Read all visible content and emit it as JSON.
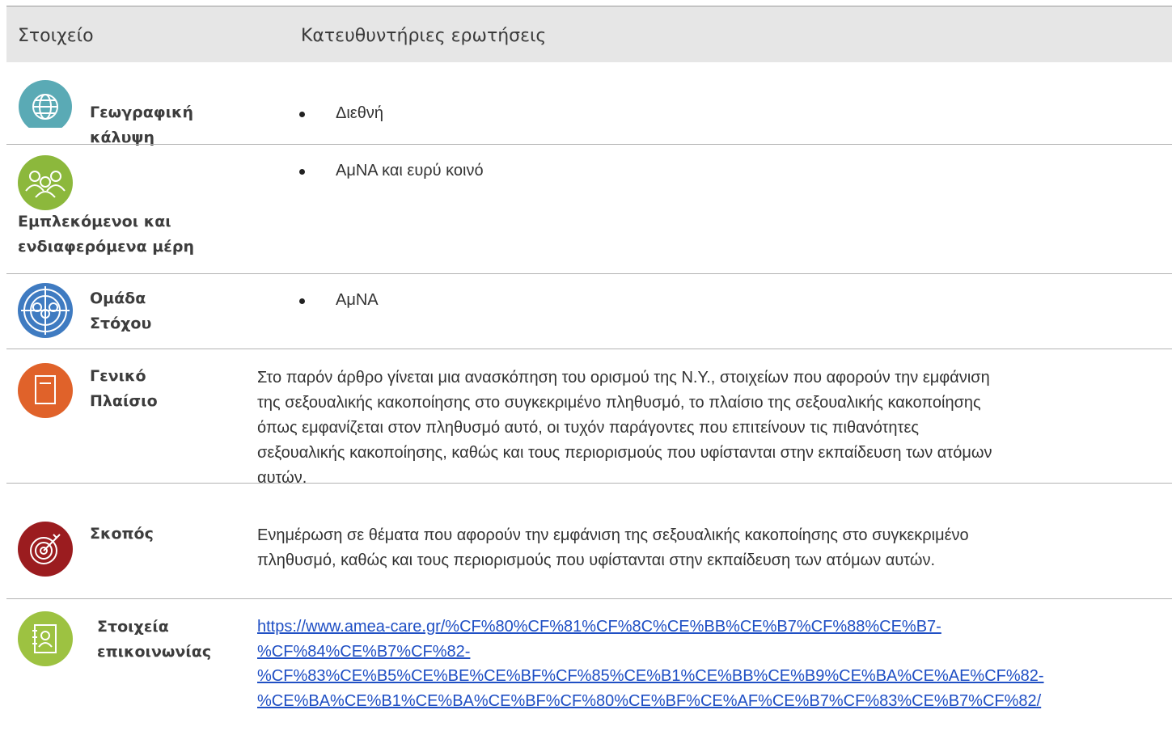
{
  "header": {
    "col1": "Στοιχείο",
    "col2": "Κατευθυντήριες ερωτήσεις"
  },
  "rows": {
    "geo": {
      "icon": "globe-icon",
      "color": "#56a9b4",
      "label_l1": "Γεωγραφική",
      "label_l2": "κάλυψη",
      "bullet": "Διεθνή"
    },
    "stake": {
      "icon": "people-group-icon",
      "color": "#8cb83c",
      "label_l1": "Εμπλεκόμενοι και",
      "label_l2": "ενδιαφερόμενα μέρη",
      "bullet": "ΑμΝΑ και ευρύ κοινό"
    },
    "target": {
      "icon": "target-group-icon",
      "color": "#3f7bc1",
      "label_l1": "Ομάδα",
      "label_l2": "Στόχου",
      "bullet": "ΑμΝΑ"
    },
    "context": {
      "icon": "document-icon",
      "color": "#e0622a",
      "label_l1": "Γενικό",
      "label_l2": "Πλαίσιο",
      "lines": [
        "Στο παρόν άρθρο γίνεται μια ανασκόπηση του ορισμού της Ν.Υ., στοιχείων που αφορούν την εμφάνιση",
        "της σεξουαλικής κακοποίησης στο συγκεκριμένο πληθυσμό, το πλαίσιο της σεξουαλικής κακοποίησης",
        "όπως εμφανίζεται στον πληθυσμό αυτό, οι τυχόν παράγοντες που επιτείνουν τις πιθανότητες",
        "σεξουαλικής κακοποίησης, καθώς και τους περιορισμούς που υφίστανται στην εκπαίδευση των ατόμων",
        "αυτών."
      ]
    },
    "goal": {
      "icon": "target-arrow-icon",
      "color": "#9b1c1f",
      "label": "Σκοπός",
      "lines": [
        "Ενημέρωση σε θέματα που αφορούν την εμφάνιση της σεξουαλικής κακοποίησης στο συγκεκριμένο",
        "πληθυσμό, καθώς και τους περιορισμούς που υφίστανται στην εκπαίδευση των ατόμων αυτών."
      ]
    },
    "contact": {
      "icon": "contact-book-icon",
      "color": "#9dc241",
      "label_l1": "Στοιχεία",
      "label_l2": "επικοινωνίας",
      "link_lines": [
        "https://www.amea-care.gr/%CF%80%CF%81%CF%8C%CE%BB%CE%B7%CF%88%CE%B7-",
        "%CF%84%CE%B7%CF%82-",
        "%CF%83%CE%B5%CE%BE%CE%BF%CF%85%CE%B1%CE%BB%CE%B9%CE%BA%CE%AE%CF%82-",
        "%CE%BA%CE%B1%CE%BA%CE%BF%CF%80%CE%BF%CE%AF%CE%B7%CF%83%CE%B7%CF%82/"
      ]
    }
  }
}
